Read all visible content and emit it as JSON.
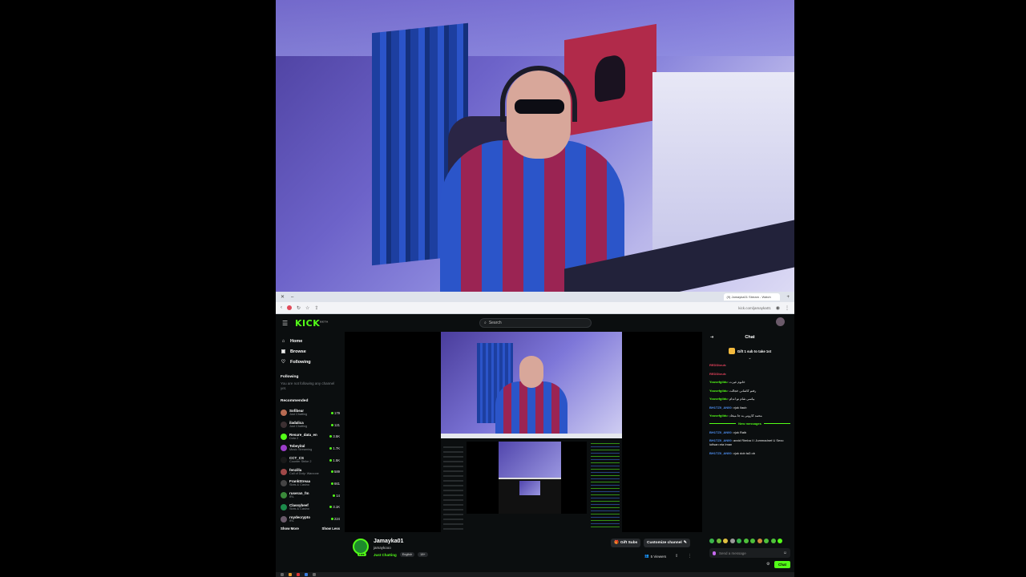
{
  "browser": {
    "tab_title": "(9) Jamayka01 Stream - Watch",
    "url": "kick.com/jamayka01"
  },
  "header": {
    "logo": "KICK",
    "search_placeholder": "Search"
  },
  "sidebar": {
    "nav": [
      {
        "label": "Home",
        "icon": "home-icon"
      },
      {
        "label": "Browse",
        "icon": "browse-icon"
      },
      {
        "label": "Following",
        "icon": "heart-icon"
      }
    ],
    "following_title": "Following",
    "following_empty": "You are not following any channel yet.",
    "recommended_title": "Recommended",
    "recommended": [
      {
        "name": "Sofibear",
        "category": "Just Chatting",
        "viewers": "179",
        "color": "#b86b52"
      },
      {
        "name": "iladalica",
        "category": "Just Chatting",
        "viewers": "121",
        "color": "#3c3032"
      },
      {
        "name": "Resure_data_en",
        "category": "Dota 2",
        "viewers": "3.5K",
        "color": "#53fc18"
      },
      {
        "name": "Tobeyital",
        "category": "Music Streaming",
        "viewers": "1.7K",
        "color": "#9b3ec8"
      },
      {
        "name": "CCT_CS",
        "category": "Counter Strike 2",
        "viewers": "1.5K",
        "color": "#1a1a1a"
      },
      {
        "name": "fenzilla",
        "category": "Call of Duty: Warzone",
        "viewers": "589",
        "color": "#a04848"
      },
      {
        "name": "FrankStreaa",
        "category": "Slots & Casino",
        "viewers": "661",
        "color": "#444"
      },
      {
        "name": "ruseran_fm",
        "category": "IRL",
        "viewers": "14",
        "color": "#3a8a3a"
      },
      {
        "name": "Classybeef",
        "category": "Slots & Casino",
        "viewers": "3.1K",
        "color": "#1c8a4a"
      },
      {
        "name": "roydecrypto",
        "category": "IRL",
        "viewers": "224",
        "color": "#6a5a6a"
      }
    ],
    "show_more": "Show More",
    "show_less": "Show Less"
  },
  "stream": {
    "channel": "Jamayka01",
    "username": "jamaykooo",
    "category": "Just Chatting",
    "tags": [
      "English",
      "18+"
    ],
    "live_badge": "LIVE",
    "gift_subs": "Gift Subs",
    "customize": "Customize channel",
    "viewers": "5 Viewers"
  },
  "chat": {
    "title": "Chat",
    "gift_banner": "Gift 1 sub to take 1st",
    "new_messages": "New messages",
    "messages": [
      {
        "user": "REDDbruh",
        "text": "",
        "user_color": "red"
      },
      {
        "user": "REDDbruh",
        "text": "",
        "user_color": "red"
      },
      {
        "user": "Yousefgildu",
        "text": "خانوم غیرت",
        "user_color": "green"
      },
      {
        "user": "Yousefgildu",
        "text": "رفتم کاشانی خجالت",
        "user_color": "green"
      },
      {
        "user": "Yousefgildu",
        "text": "بیاسی شام تو اندام",
        "user_color": "green"
      },
      {
        "user": "BH1TZ0_AN00",
        "text": "vjuk ilaub",
        "user_color": "blue"
      },
      {
        "user": "Yousefgildu",
        "text": "محمد کاروتی به جا میخاد",
        "user_color": "green"
      },
      {
        "user": "BH1TZ0_AN00",
        "text": "vjuk Raib",
        "user_color": "blue"
      },
      {
        "user": "BH1TZ0_AN00",
        "text": "avxid Rimba I I Jummadnet U Sexo iufisan eta Iman",
        "user_color": "blue"
      },
      {
        "user": "BH1TZ0_AN00",
        "text": "vjuk dob ta3 ob",
        "user_color": "blue"
      }
    ],
    "input_placeholder": "Send a message",
    "send_label": "Chat"
  }
}
